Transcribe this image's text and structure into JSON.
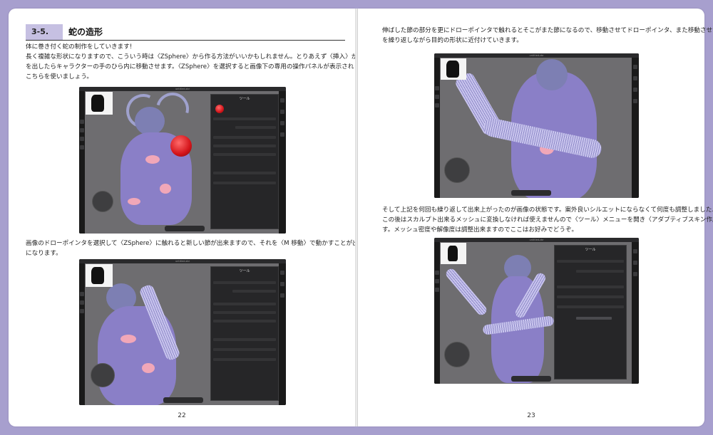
{
  "left_page": {
    "section_number": "3-5.",
    "section_title": "蛇の造形",
    "para1": [
      "体に巻き付く蛇の制作をしていきます!",
      "長く複雑な形状になりますので、こういう時は〈ZSphere〉から作る方法がいいかもしれません。とりあえず〈挿入〉から〈ZSphere〉",
      "を出したらキャラクターの手のひら内に移動させます。〈ZSphere〉を選択すると画像下の専用の操作パネルが表示されますので",
      "こちらを使いましょう。"
    ],
    "para2": [
      "画像のドローポインタを選択して〈ZSphere〉に触れると新しい節が出来ますので、それを〈M 移動〉で動かすことが出来るよう",
      "になります。"
    ],
    "page_number": "22"
  },
  "right_page": {
    "para1": [
      "伸ばした節の部分を更にドローポインタで触れるとそこがまた節になるので、移動させてドローポインタ、また移動させて……。",
      "を繰り返しながら目的の形状に近付けていきます。"
    ],
    "para2": [
      "そして上記を何回も繰り返して出来上がったのが画像の状態です。案外良いシルエットにならなくて何度も調整しました……。",
      "この後はスカルプト出来るメッシュに変換しなければ使えませんので〈ツール〉メニューを開き〈アダプティブスキン作成〉をしま",
      "す。メッシュ密度や解像度は調整出来ますのでここはお好みでどうぞ。"
    ],
    "page_number": "23"
  },
  "screenshots": {
    "shot1": {
      "filename": "untitled.zbr",
      "panel_title": "ツール",
      "icon": "zsphere-red-ball"
    },
    "shot2": {
      "filename": "untitled.zbr",
      "panel_title": "ツール",
      "icon": "zsphere-tube"
    },
    "shot3": {
      "filename": "untitled.zbr",
      "icon": "snake-tube"
    },
    "shot4": {
      "filename": "untitled.zbr",
      "panel_title": "ツール",
      "icon": "snake-wrapped-figure"
    }
  },
  "colors": {
    "background": "#a79fce",
    "section_band": "#c6c0e2",
    "model": "#8a7fc7",
    "accent_pink": "#f1a7b8"
  }
}
